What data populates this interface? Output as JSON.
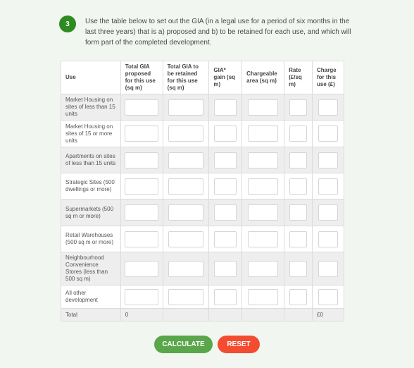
{
  "step": {
    "number": "3",
    "text": "Use the table below to set out the GIA (in a legal use for a period of six months in the last three years) that is a) proposed and b) to be retained for each use, and which will form part of the completed development."
  },
  "table": {
    "headers": [
      "Use",
      "Total GIA proposed for this use (sq m)",
      "Total GIA to be retained for this use (sq m)",
      "GIA* gain (sq m)",
      "Chargeable area (sq m)",
      "Rate (£/sq m)",
      "Charge for this use (£)"
    ],
    "rows": [
      {
        "use": "Market Housing on sites of less than 15 units"
      },
      {
        "use": "Market Housing on sites of 15 or more units"
      },
      {
        "use": "Apartments on sites of less than 15 units"
      },
      {
        "use": "Strategic Sites (500 dwellings or more)"
      },
      {
        "use": "Supermarkets (500 sq m or more)"
      },
      {
        "use": "Retail Warehouses (500 sq m or more)"
      },
      {
        "use": "Neighbourhood Convenience Stores (less than 500 sq m)"
      },
      {
        "use": "All other development"
      }
    ],
    "total": {
      "label": "Total",
      "gia_proposed": "0",
      "charge": "£0"
    }
  },
  "buttons": {
    "calculate": "CALCULATE",
    "reset": "RESET"
  },
  "colors": {
    "step_badge": "#2e8b22",
    "calculate": "#5aa64b",
    "reset": "#f44c30"
  }
}
